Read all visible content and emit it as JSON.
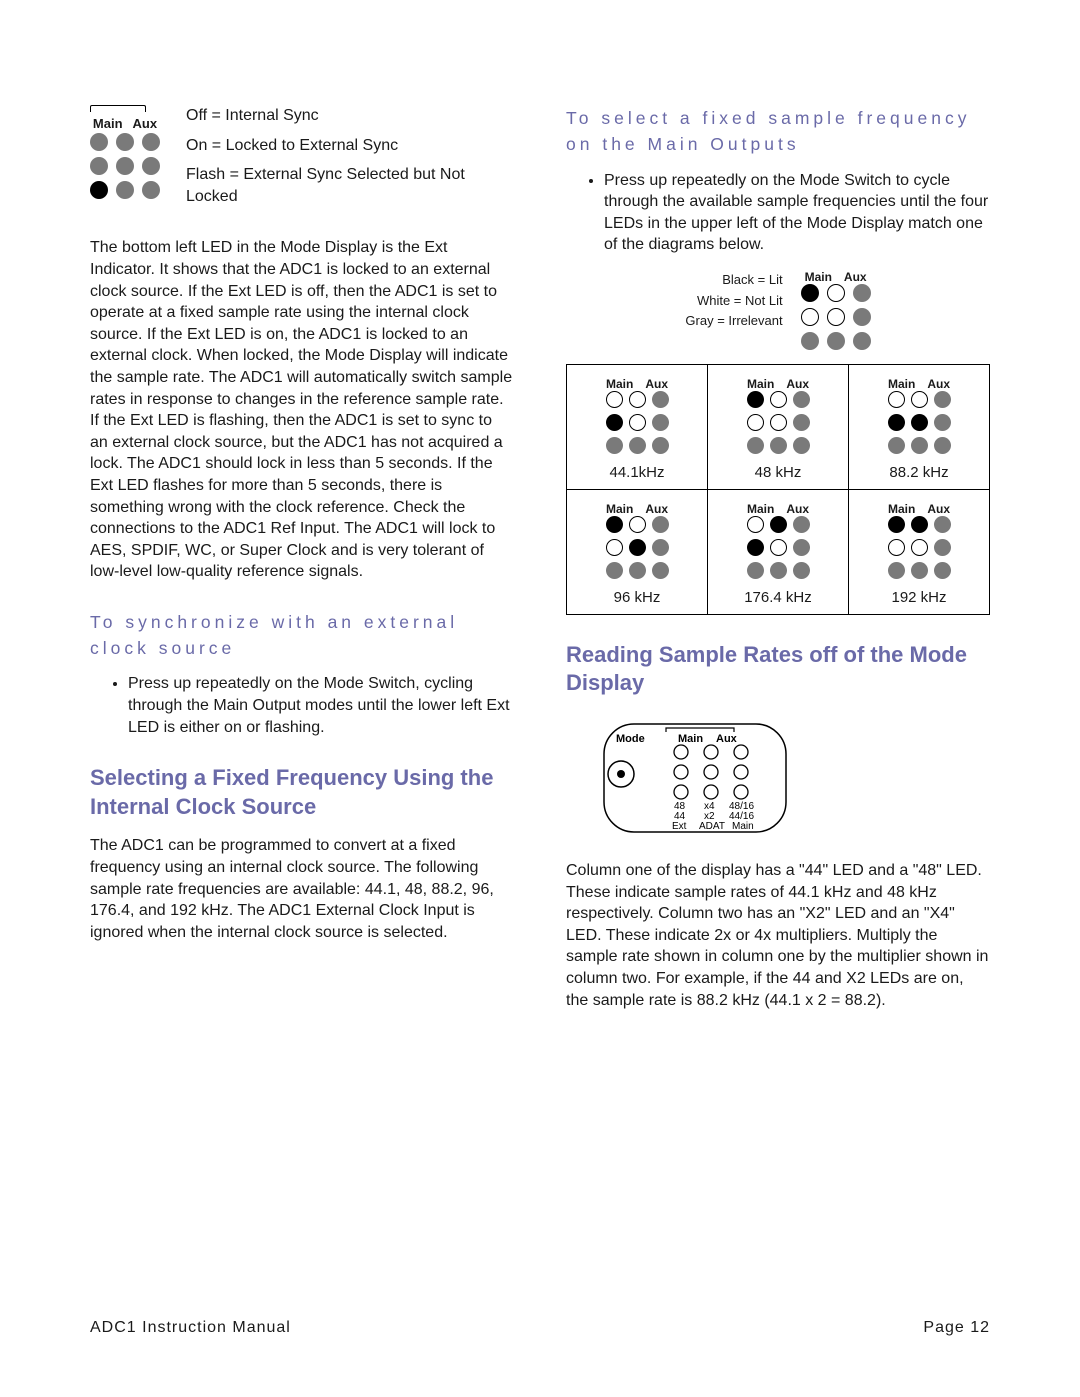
{
  "lead_diagram": {
    "col_labels": {
      "main": "Main",
      "aux": "Aux"
    },
    "legend": {
      "off": "Off = Internal Sync",
      "on": "On = Locked to External Sync",
      "flash": "Flash = External Sync Selected but Not Locked"
    }
  },
  "left": {
    "para1": "The bottom left LED in the Mode Display is the Ext Indicator. It shows that the ADC1 is locked to an external clock source. If the Ext LED is off, then the ADC1 is set to operate at a fixed sample rate using the internal clock source. If the Ext LED is on, the ADC1 is locked to an external clock. When locked, the Mode Display will indicate the sample rate. The ADC1 will automatically switch sample rates in response to changes in the reference sample rate. If the Ext LED is flashing, then the ADC1 is set to sync to an external clock source, but the ADC1 has not acquired a lock. The ADC1 should lock in less than 5 seconds. If the Ext LED flashes for more than 5 seconds, there is something wrong with the clock reference. Check the connections to the ADC1 Ref Input. The ADC1 will lock to AES, SPDIF, WC, or Super Clock and is very tolerant of low-level low-quality reference signals.",
    "sub1": "To synchronize with an external clock source",
    "bul1": "Press up repeatedly on the Mode Switch, cycling through the Main Output modes until the lower left Ext LED is either on or flashing.",
    "h2a": "Selecting a Fixed Frequency Using the Internal Clock Source",
    "para2": "The ADC1 can be programmed to convert at a fixed frequency using an internal clock source. The following sample rate frequencies are available: 44.1, 48, 88.2, 96, 176.4, and 192 kHz. The ADC1 External Clock Input is ignored when the internal clock source is selected."
  },
  "right": {
    "sub1": "To select a fixed sample frequency on the Main Outputs",
    "bul1": "Press up repeatedly on the Mode Switch to cycle through the available sample frequencies until the four LEDs in the upper left of the Mode Display match one of the diagrams below.",
    "key": {
      "black": "Black = Lit",
      "white": "White = Not Lit",
      "gray": "Gray = Irrelevant",
      "main": "Main",
      "aux": "Aux"
    },
    "diagrams": [
      {
        "cap": "44.1kHz",
        "rows": [
          [
            "notlit",
            "notlit",
            "irr"
          ],
          [
            "lit",
            "notlit",
            "irr"
          ],
          [
            "irr",
            "irr",
            "irr"
          ]
        ]
      },
      {
        "cap": "48 kHz",
        "rows": [
          [
            "lit",
            "notlit",
            "irr"
          ],
          [
            "notlit",
            "notlit",
            "irr"
          ],
          [
            "irr",
            "irr",
            "irr"
          ]
        ]
      },
      {
        "cap": "88.2 kHz",
        "rows": [
          [
            "notlit",
            "notlit",
            "irr"
          ],
          [
            "lit",
            "lit",
            "irr"
          ],
          [
            "irr",
            "irr",
            "irr"
          ]
        ]
      },
      {
        "cap": "96 kHz",
        "rows": [
          [
            "lit",
            "notlit",
            "irr"
          ],
          [
            "notlit",
            "lit",
            "irr"
          ],
          [
            "irr",
            "irr",
            "irr"
          ]
        ]
      },
      {
        "cap": "176.4 kHz",
        "rows": [
          [
            "notlit",
            "lit",
            "irr"
          ],
          [
            "lit",
            "notlit",
            "irr"
          ],
          [
            "irr",
            "irr",
            "irr"
          ]
        ]
      },
      {
        "cap": "192 kHz",
        "rows": [
          [
            "lit",
            "lit",
            "irr"
          ],
          [
            "notlit",
            "notlit",
            "irr"
          ],
          [
            "irr",
            "irr",
            "irr"
          ]
        ]
      }
    ],
    "h2b": "Reading Sample Rates off of the Mode Display",
    "mode_fig": {
      "mode": "Mode",
      "main": "Main",
      "aux": "Aux",
      "row_labels": {
        "a1": "48",
        "a2": "x4",
        "a3": "48/16",
        "b1": "44",
        "b2": "x2",
        "b3": "44/16",
        "c1": "Ext",
        "c2": "ADAT",
        "c3": "Main"
      }
    },
    "para1": "Column one of the display has a \"44\" LED and a \"48\" LED. These indicate sample rates of 44.1 kHz and 48 kHz respectively. Column two has an \"X2\" LED and an \"X4\" LED. These indicate 2x or 4x multipliers. Multiply the sample rate shown in column one by the multiplier shown in column two. For example, if the 44 and X2 LEDs are on, the sample rate is 88.2 kHz (44.1 x 2 = 88.2)."
  },
  "footer": {
    "left": "ADC1 Instruction Manual",
    "right": "Page 12"
  }
}
